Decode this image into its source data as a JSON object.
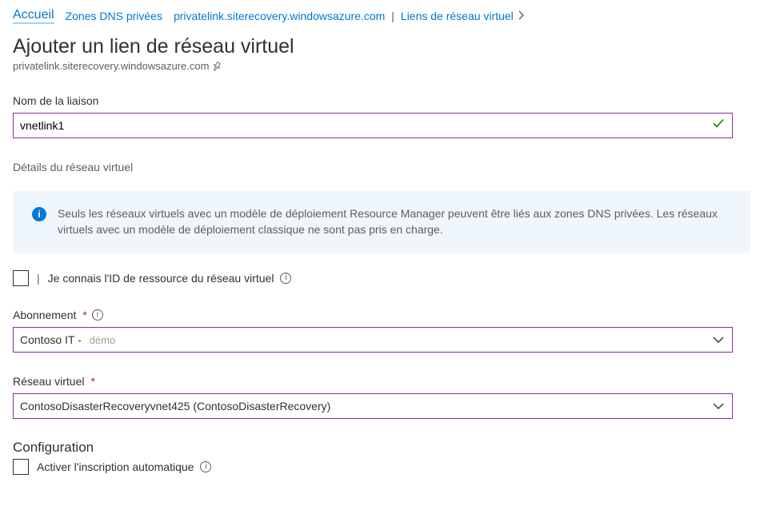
{
  "breadcrumb": {
    "home": "Accueil",
    "zones": "Zones DNS privées",
    "zone_name": "privatelink.siterecovery.windowsazure.com",
    "links": "Liens de réseau virtuel"
  },
  "page": {
    "title": "Ajouter un lien de réseau virtuel",
    "subtitle": "privatelink.siterecovery.windowsazure.com"
  },
  "fields": {
    "link_name_label": "Nom de la liaison",
    "link_name_value": "vnetlink1",
    "vnet_details_label": "Détails du réseau virtuel",
    "info_banner": "Seuls les réseaux virtuels avec un modèle de déploiement Resource Manager peuvent être liés aux zones DNS privées. Les réseaux virtuels avec un modèle de déploiement classique ne sont pas pris en charge.",
    "know_resource_id_label": "Je connais l'ID de ressource du réseau virtuel",
    "subscription_label": "Abonnement",
    "subscription_value": "Contoso IT -",
    "subscription_value_suffix": "démo",
    "vnet_label": "Réseau virtuel",
    "vnet_value": "ContosoDisasterRecoveryvnet425 (ContosoDisasterRecovery)",
    "config_heading": "Configuration",
    "auto_register_label": "Activer l'inscription automatique"
  }
}
